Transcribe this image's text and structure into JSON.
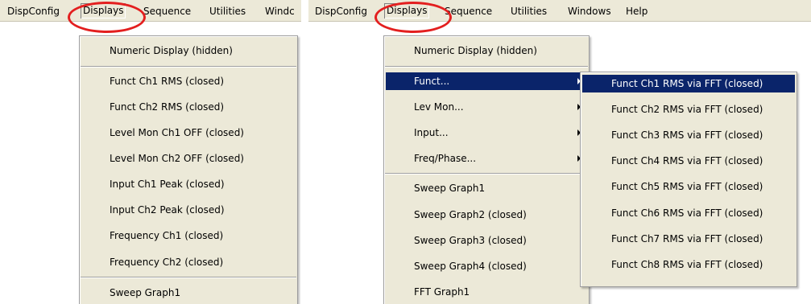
{
  "left": {
    "menubar": [
      "DispConfig",
      "Displays",
      "Sequence",
      "Utilities",
      "Windc"
    ],
    "displays_menu": [
      "Numeric Display (hidden)",
      "Funct Ch1 RMS (closed)",
      "Funct Ch2 RMS (closed)",
      "Level Mon Ch1 OFF (closed)",
      "Level Mon Ch2 OFF (closed)",
      "Input Ch1 Peak (closed)",
      "Input Ch2 Peak (closed)",
      "Frequency Ch1 (closed)",
      "Frequency Ch2 (closed)",
      "Sweep Graph1"
    ]
  },
  "right": {
    "menubar": [
      "DispConfig",
      "Displays",
      "Sequence",
      "Utilities",
      "Windows",
      "Help"
    ],
    "displays_menu": [
      "Numeric Display (hidden)",
      "Funct...",
      "Lev Mon...",
      "Input...",
      "Freq/Phase...",
      "Sweep Graph1",
      "Sweep Graph2 (closed)",
      "Sweep Graph3 (closed)",
      "Sweep Graph4 (closed)",
      "FFT Graph1"
    ],
    "funct_submenu": [
      "Funct Ch1 RMS via FFT (closed)",
      "Funct Ch2 RMS via FFT (closed)",
      "Funct Ch3 RMS via FFT (closed)",
      "Funct Ch4 RMS via FFT (closed)",
      "Funct Ch5 RMS via FFT (closed)",
      "Funct Ch6 RMS via FFT (closed)",
      "Funct Ch7 RMS via FFT (closed)",
      "Funct Ch8 RMS via FFT (closed)"
    ]
  },
  "colors": {
    "menu_bg": "#ece9d8",
    "selection_bg": "#0a246a",
    "annotation_ring": "#e31f1f"
  }
}
